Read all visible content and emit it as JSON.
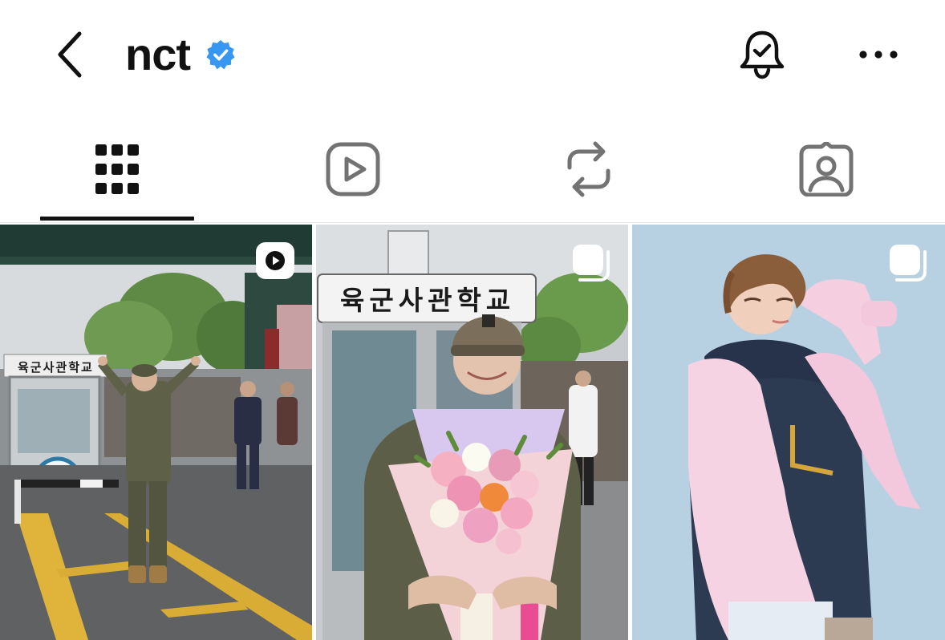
{
  "header": {
    "title": "nct",
    "verified": true,
    "back_icon": "chevron-left-icon",
    "bell_icon": "bell-check-icon",
    "more_icon": "more-horizontal-icon"
  },
  "tabs": [
    {
      "name": "posts",
      "icon": "grid-icon",
      "active": true
    },
    {
      "name": "reels",
      "icon": "reels-icon",
      "active": false
    },
    {
      "name": "reposts",
      "icon": "repost-icon",
      "active": false
    },
    {
      "name": "tagged",
      "icon": "tagged-icon",
      "active": false
    }
  ],
  "posts": [
    {
      "type": "reel",
      "badge_icon": "play-icon",
      "sign_text": "육군사관학교"
    },
    {
      "type": "carousel",
      "badge_icon": "multiple-icon",
      "sign_text": "육군사관학교"
    },
    {
      "type": "carousel",
      "badge_icon": "multiple-icon"
    }
  ],
  "colors": {
    "verified_blue": "#3897f0",
    "text": "#111111",
    "tab_inactive": "#737373",
    "divider": "#e6e6e6"
  }
}
